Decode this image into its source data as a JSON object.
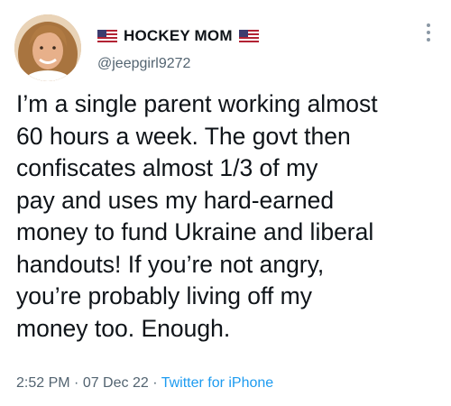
{
  "author": {
    "display_name": "HOCKEY MOM",
    "handle": "@jeepgirl9272",
    "flag_icon": "us-flag-icon"
  },
  "tweet": {
    "lines": [
      "I’m a single parent working almost",
      "60 hours a week. The govt then",
      "confiscates almost 1/3 of my",
      "pay and uses my hard-earned",
      "money to fund Ukraine and liberal",
      "handouts!  If you’re not angry,",
      "you’re probably living off my",
      "money too.  Enough."
    ]
  },
  "meta": {
    "time": "2:52 PM",
    "sep1": " · ",
    "date": "07 Dec 22",
    "sep2": " · ",
    "source": "Twitter for iPhone"
  },
  "colors": {
    "text": "#0f1419",
    "secondary": "#536471",
    "link": "#1d9bf0"
  }
}
